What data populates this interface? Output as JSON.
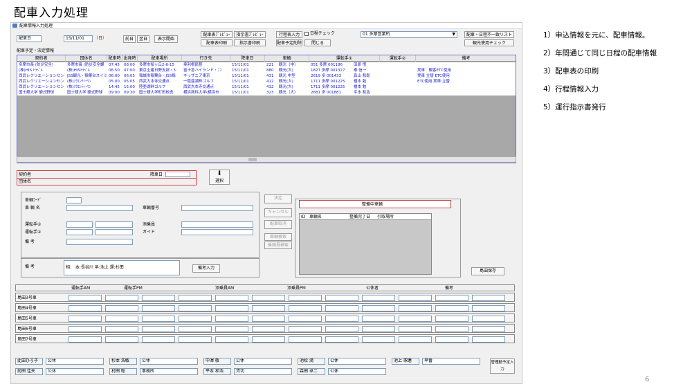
{
  "slide": {
    "title": "配車入力処理",
    "page_number": "6"
  },
  "notes": [
    "1）申込情報を元に、配車情報。",
    "2）年間通じて同じ日程の配車情報",
    "3）配車表の印刷",
    "4）行程情報入力",
    "5）運行指示書発行"
  ],
  "window": {
    "title": "配車情報入力処理"
  },
  "toolbar": {
    "date_label": "配車日",
    "date_value": "15/11/01",
    "weekday": "（日）",
    "prev": "前日",
    "next": "翌日",
    "show": "表示開始",
    "btn_preview": "配車表ﾌﾟﾚﾋﾞｭｰ",
    "btn_print": "配車表印刷",
    "btn_inst_preview": "指示書ﾌﾟﾚﾋﾞｭｰ",
    "btn_inst_print": "指示書印刷",
    "btn_itinerary": "行程表入力",
    "btn_delete": "配車予定削除",
    "day_check": "日程チェック",
    "close": "閉じる",
    "office": "01 多摩営業所",
    "btn_list": "配車・日程不一致リスト",
    "btn_tour": "観光使用チェック"
  },
  "grid": {
    "caption": "配車予定・決定情報",
    "headers": [
      "契約者",
      "団体名",
      "配車時刻",
      "出発時刻",
      "配車場所",
      "行き先",
      "降車日",
      "車輌",
      "運転手①",
      "運転手②",
      "備考"
    ],
    "rows": [
      [
        "多摩市長 (防災安全)",
        "多摩市長 (防災安全課",
        "07:45",
        "08:00",
        "多摩市桜ヶ丘2-6-15",
        "奥利根民藝",
        "15/11/01",
        "221",
        "観光（中）",
        "051 多摩 001186",
        "田原 悟",
        "",
        ""
      ],
      [
        "(株)HIS ﾄﾗﾍﾞﾙ",
        "(株)HISﾄﾗﾍﾞﾙ",
        "06:50",
        "07:00",
        "東京土建日野支部・5",
        "富士急ハイランド・ﾆｺ",
        "15/11/01",
        "880",
        "観光(大)",
        "1827 多摩 001327",
        "泰 信一",
        "",
        "実車：観客ETC使用"
      ],
      [
        "西武レクリエーションセン",
        "JSS観光・稲葉台スイミ",
        "06:00",
        "06:05",
        "稲城市稲葉台・JSS稲",
        "キッザニア東京",
        "15/11/01",
        "431",
        "観光 中型",
        "2619 多 001433",
        "真山 和郎",
        "",
        "実車 立替 ETC使用"
      ],
      [
        "西武レクリエーションセン",
        "(株)ｱｸｴﾝﾃｨｰﾜﾝ",
        "05:00",
        "05:05",
        "西武大本寺交通点",
        "一陸亜湖畔ゴルフ",
        "15/11/01",
        "412",
        "観光(大)",
        "1711 多摩 001225",
        "榎本 勉",
        "",
        "ETC使用 実車:立替"
      ],
      [
        "西武レクリエーションセン",
        "(株)ｱｸｴﾝﾃｨｰﾜﾝ",
        "14:45",
        "15:00",
        "陸亜湖畔ゴルフ",
        "西武大本寺交通点",
        "15/11/01",
        "412",
        "観光(大)",
        "1711 多摩 001225",
        "榎本 勉",
        "",
        ""
      ],
      [
        "国士舘大学 硬式野球",
        "国士舘大学 硬式野球",
        "09:00",
        "09:30",
        "国士舘大学町田校舎",
        "横浜商科大学(横浜市",
        "15/11/01",
        "323",
        "観光（大）",
        "2681 多 001881",
        "平本 和浩",
        "",
        ""
      ]
    ]
  },
  "form": {
    "contractor": "契約者",
    "group": "団体名",
    "drop_date": "降車日",
    "select": "選択",
    "vehicle_code": "車輌ｺｰﾄﾞ",
    "vehicle_name": "車 輌 名",
    "vehicle_no": "車輌番号",
    "driver1": "運転手①",
    "driver2": "運転手②",
    "attendant": "添乗員",
    "guide": "ガイド",
    "remarks": "備 考",
    "btn_decide": "決定",
    "btn_cancel": "キャンセル",
    "btn_release": "配車取消",
    "btn_vsearch": "車輌検索",
    "btn_psearch": "乗務員検索",
    "remarks2": "備 考",
    "remarks2_value": "相： 本:長谷川 早:池上 遅:杉田",
    "btn_remarks": "備考入力",
    "maint_title": "整備中車輌",
    "maint_headers": [
      "ID",
      "車輌名",
      "整備完了日",
      "引取場所"
    ],
    "btn_save": "島田保存"
  },
  "shift": {
    "headers": [
      "運転手AM",
      "運転手PM",
      "添乗員AM",
      "添乗員PM",
      "公休者",
      "備考"
    ],
    "rows": [
      "島田3号車",
      "島田4号車",
      "島田5号車",
      "島田6号車",
      "島田7号車"
    ]
  },
  "staff": [
    [
      [
        "此田ひろ子",
        "公休"
      ],
      [
        "杉本 浩敏",
        "公休"
      ],
      [
        "中澤 敬",
        "公休"
      ],
      [
        "池松 満",
        "公休"
      ],
      [
        "池上 琢磨",
        "早番"
      ]
    ],
    [
      [
        "前田 佳夫",
        "公休"
      ],
      [
        "村田 聡",
        "事務所"
      ],
      [
        "平本 和浩",
        "貸切"
      ],
      [
        "森田 卓二",
        "公休"
      ],
      [
        "",
        ""
      ]
    ]
  ],
  "staff_btn": "管理勤予定入力"
}
